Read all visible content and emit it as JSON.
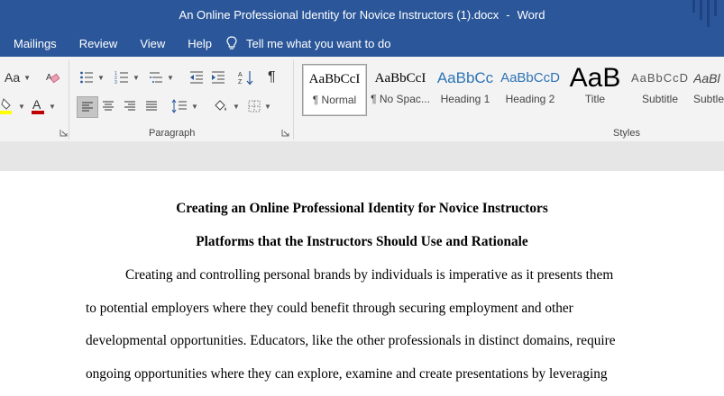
{
  "titlebar": {
    "document_name": "An Online Professional Identity for Novice Instructors (1).docx",
    "separator": "-",
    "app_name": "Word"
  },
  "menubar": {
    "tabs": [
      "Mailings",
      "Review",
      "View",
      "Help"
    ],
    "tell_me": "Tell me what you want to do"
  },
  "ribbon": {
    "font_size_label": "Aa",
    "paragraph_group_label": "Paragraph",
    "styles_group_label": "Styles",
    "highlight_color": "#ffff00",
    "font_color": "#c00000",
    "styles": [
      {
        "preview": "AaBbCcI",
        "name": "¶ Normal"
      },
      {
        "preview": "AaBbCcI",
        "name": "¶ No Spac..."
      },
      {
        "preview": "AaBbCc",
        "name": "Heading 1"
      },
      {
        "preview": "AaBbCcD",
        "name": "Heading 2"
      },
      {
        "preview": "AaB",
        "name": "Title"
      },
      {
        "preview": "AaBbCcD",
        "name": "Subtitle"
      },
      {
        "preview": "AaBl",
        "name": "Subtle"
      }
    ]
  },
  "document": {
    "title": "Creating an Online Professional Identity for Novice Instructors",
    "subtitle": "Platforms that the Instructors Should Use and Rationale",
    "lines": [
      "Creating and controlling personal brands by individuals is imperative as it presents them",
      "to potential employers where they could benefit through securing employment and other",
      "developmental opportunities. Educators, like the other professionals in distinct domains, require",
      "ongoing opportunities where they can explore, examine and create presentations by leveraging"
    ]
  }
}
